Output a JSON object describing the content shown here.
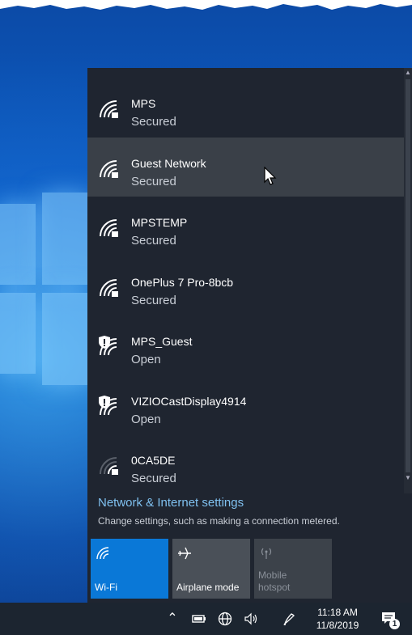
{
  "networks": [
    {
      "name": "MPS",
      "status": "Secured",
      "shield": false
    },
    {
      "name": "Guest Network",
      "status": "Secured",
      "shield": false
    },
    {
      "name": "MPSTEMP",
      "status": "Secured",
      "shield": false
    },
    {
      "name": "OnePlus 7 Pro-8bcb",
      "status": "Secured",
      "shield": false
    },
    {
      "name": "MPS_Guest",
      "status": "Open",
      "shield": true
    },
    {
      "name": "VIZIOCastDisplay4914",
      "status": "Open",
      "shield": true
    },
    {
      "name": "0CA5DE",
      "status": "Secured",
      "shield": false
    }
  ],
  "settings": {
    "link": "Network & Internet settings",
    "description": "Change settings, such as making a connection metered."
  },
  "quick_actions": [
    {
      "label": "Wi-Fi",
      "state": "on",
      "icon": "wifi-icon"
    },
    {
      "label": "Airplane mode",
      "state": "off",
      "icon": "airplane-icon"
    },
    {
      "label": "Mobile\nhotspot",
      "state": "disabled",
      "icon": "hotspot-icon"
    }
  ],
  "taskbar": {
    "time": "11:18 AM",
    "date": "11/8/2019",
    "notification_count": "1"
  },
  "colors": {
    "accent": "#0a78d7",
    "flyout_bg": "#1f2530",
    "link": "#7fc0ef"
  }
}
